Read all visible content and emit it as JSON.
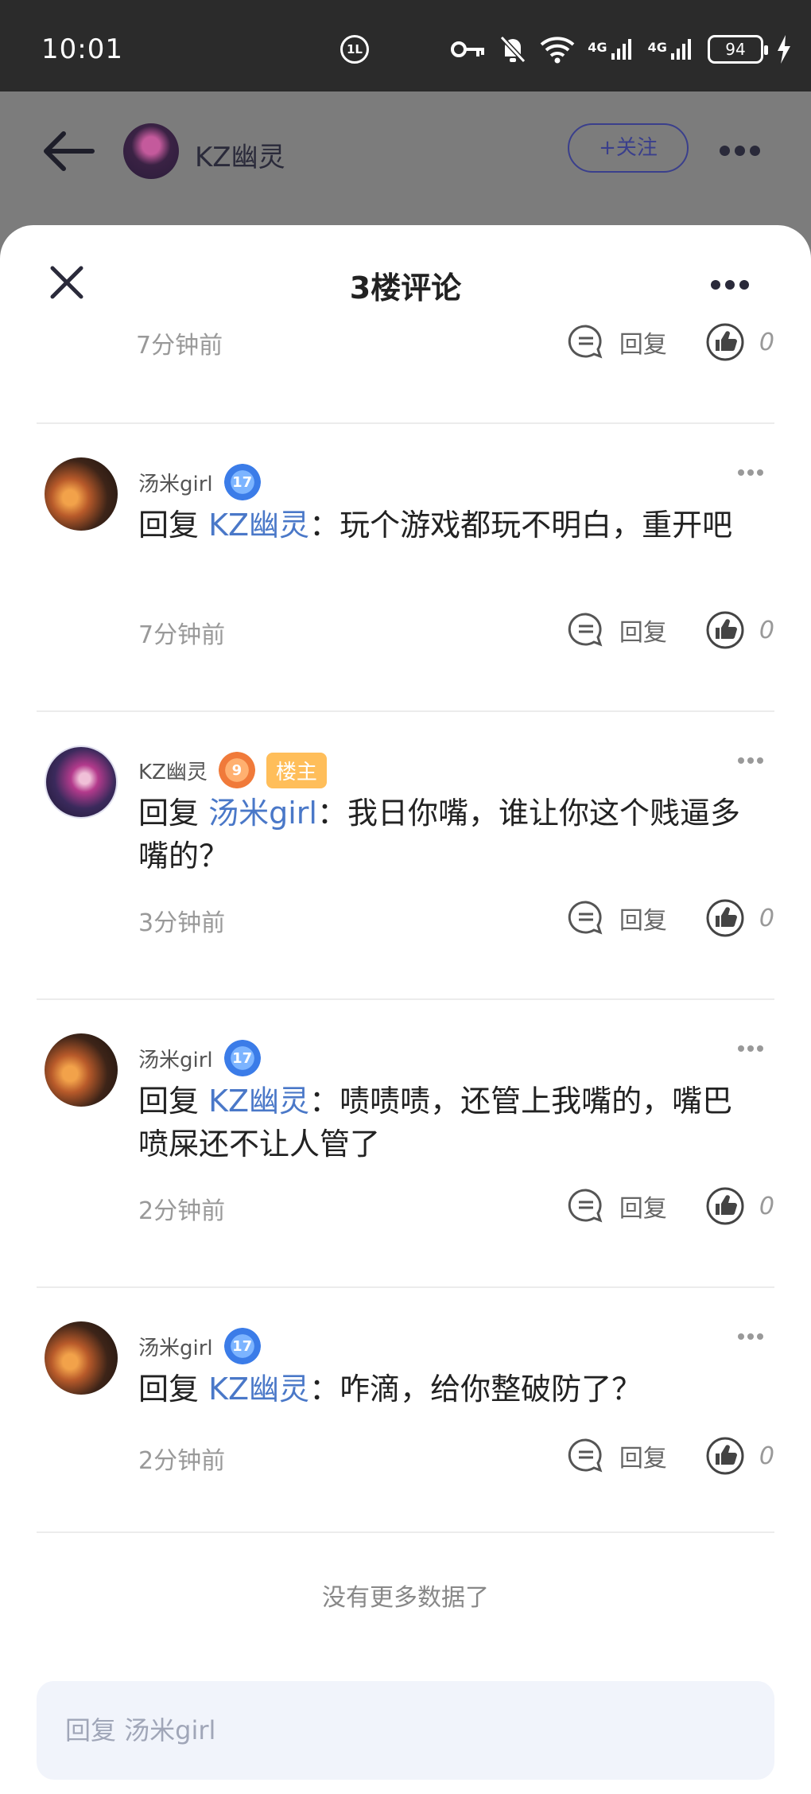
{
  "status_bar": {
    "time": "10:01",
    "hd_badge": "1L",
    "net1": "4G",
    "net2": "4G",
    "battery": "94"
  },
  "page_header": {
    "author_name": "KZ幽灵",
    "follow_label": "+关注"
  },
  "sheet": {
    "title": "3楼评论",
    "partial_row": {
      "time": "7分钟前",
      "reply_label": "回复",
      "like_count": "0"
    },
    "comments": [
      {
        "username": "汤米girl",
        "level": "17",
        "owner_tag": "",
        "reply_prefix": "回复",
        "mention": "KZ幽灵",
        "text": "：玩个游戏都玩不明白，重开吧",
        "time": "7分钟前",
        "reply_label": "回复",
        "like_count": "0"
      },
      {
        "username": "KZ幽灵",
        "level": "9",
        "owner_tag": "楼主",
        "reply_prefix": "回复",
        "mention": "汤米girl",
        "text": "：我日你嘴，谁让你这个贱逼多嘴的？",
        "time": "3分钟前",
        "reply_label": "回复",
        "like_count": "0"
      },
      {
        "username": "汤米girl",
        "level": "17",
        "owner_tag": "",
        "reply_prefix": "回复",
        "mention": "KZ幽灵",
        "text": "：啧啧啧，还管上我嘴的，嘴巴喷屎还不让人管了",
        "time": "2分钟前",
        "reply_label": "回复",
        "like_count": "0"
      },
      {
        "username": "汤米girl",
        "level": "17",
        "owner_tag": "",
        "reply_prefix": "回复",
        "mention": "KZ幽灵",
        "text": "：咋滴，给你整破防了？",
        "time": "2分钟前",
        "reply_label": "回复",
        "like_count": "0"
      }
    ],
    "no_more": "没有更多数据了",
    "reply_input": {
      "placeholder": "回复 汤米girl"
    }
  },
  "colors": {
    "mention": "#4a78c8",
    "follow": "#3a3f8c",
    "owner_tag": "#ffbe5a",
    "level_blue": "#3b7ce8",
    "level_orange": "#f07a3a"
  }
}
